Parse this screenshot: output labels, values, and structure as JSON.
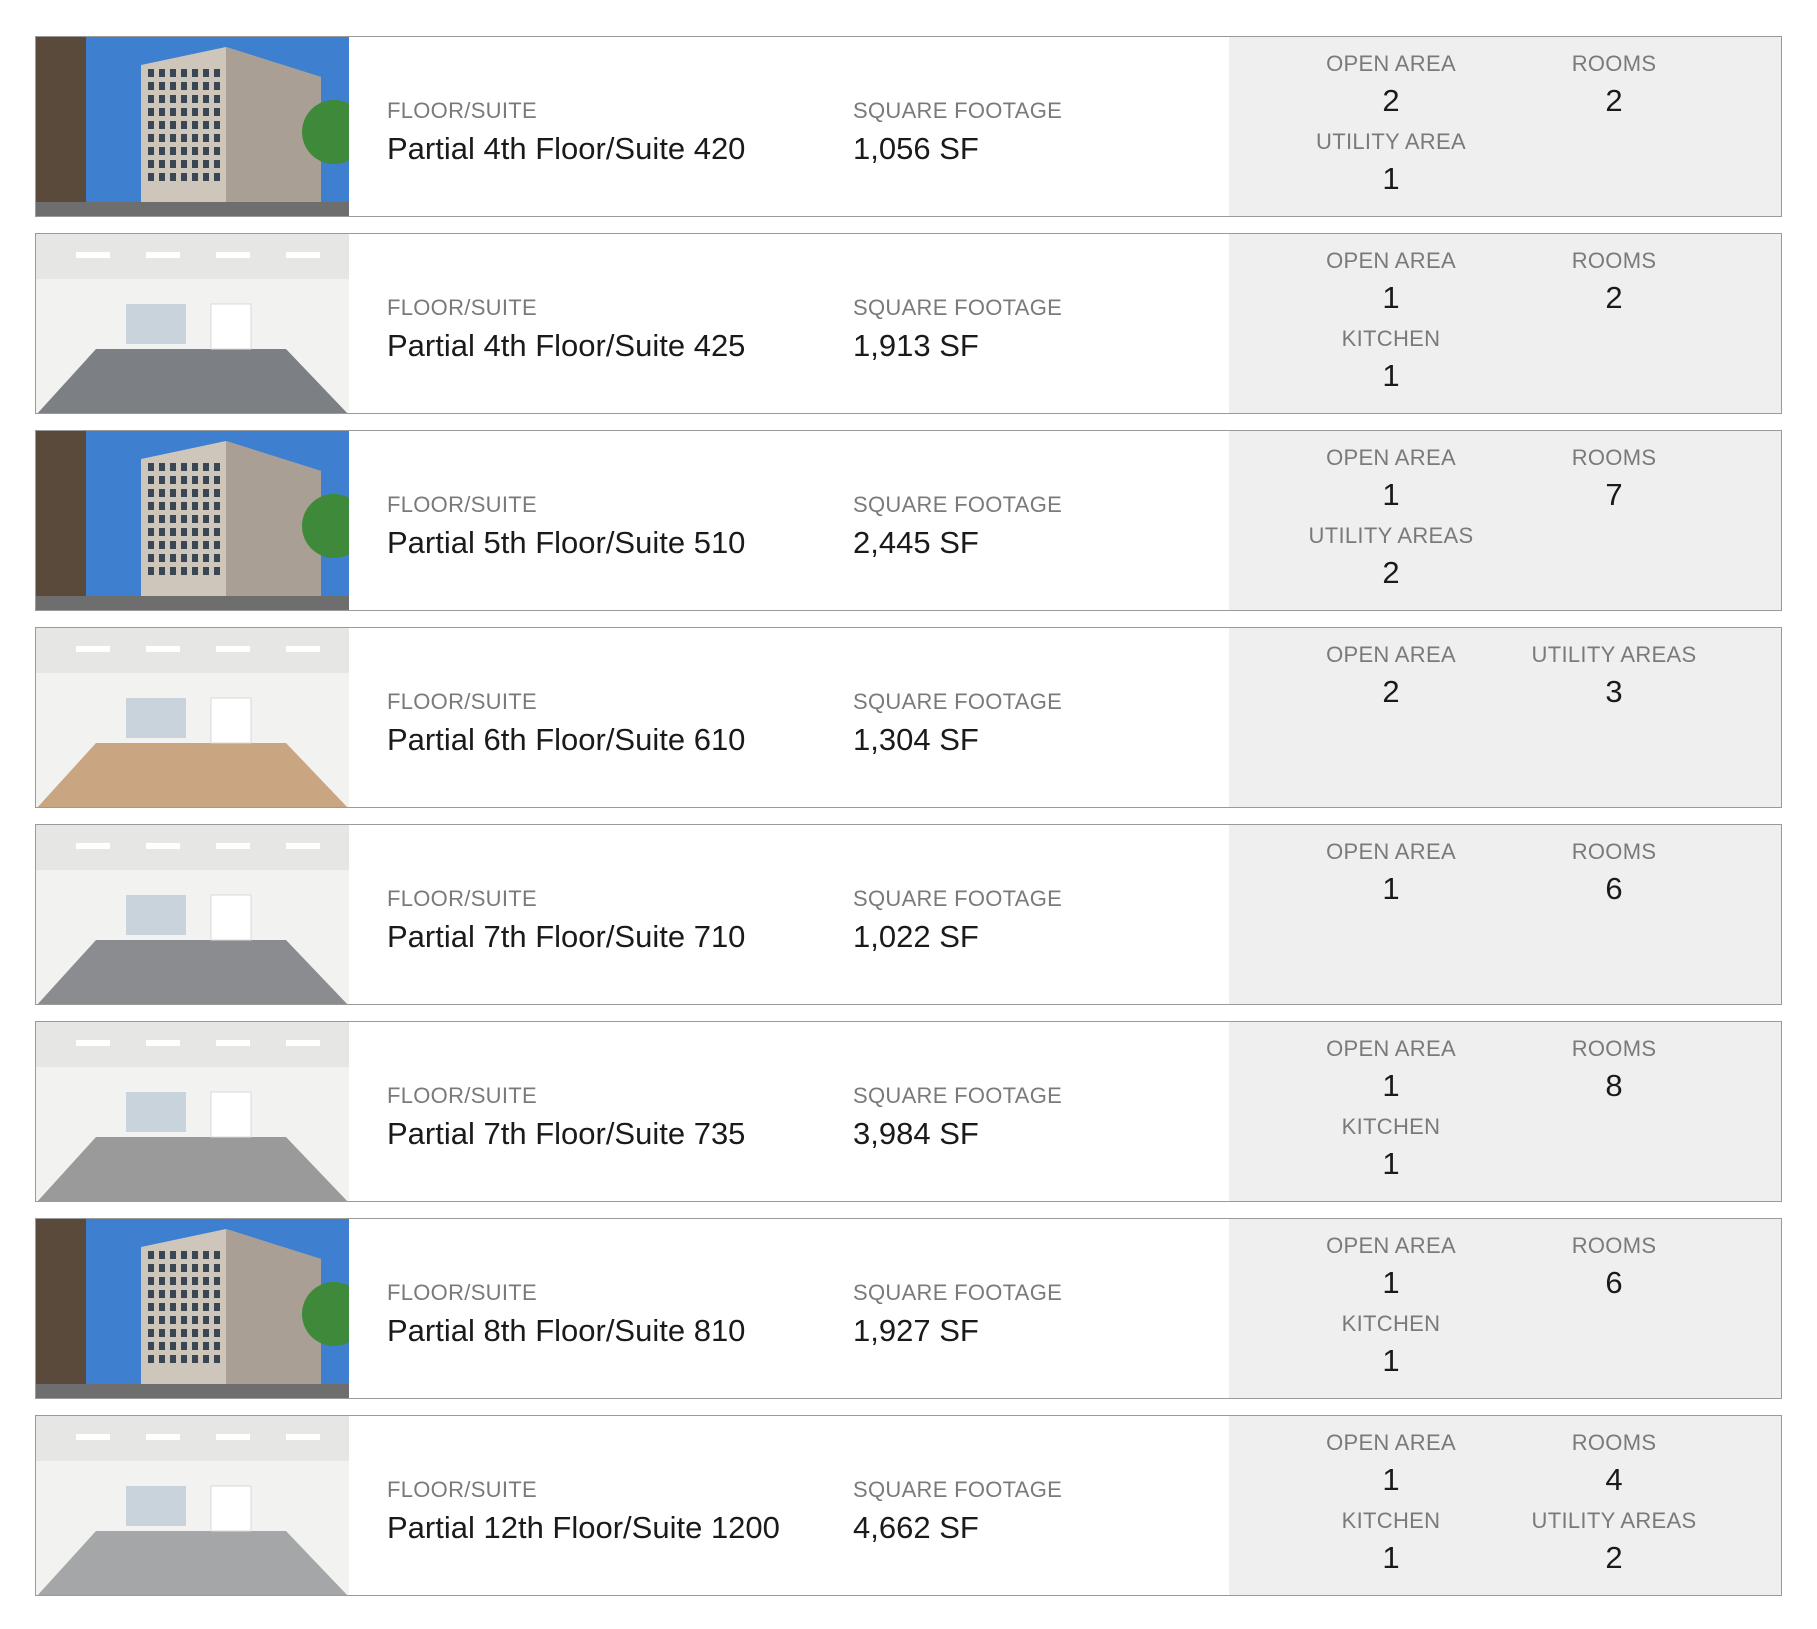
{
  "labels": {
    "floor_suite": "FLOOR/SUITE",
    "square_footage": "SQUARE FOOTAGE"
  },
  "listings": [
    {
      "photo": "building-exterior-photo",
      "suite": "Partial 4th Floor/Suite 420",
      "sf": "1,056 SF",
      "stats": [
        {
          "label": "OPEN AREA",
          "value": "2"
        },
        {
          "label": "ROOMS",
          "value": "2"
        },
        {
          "label": "UTILITY AREA",
          "value": "1"
        }
      ]
    },
    {
      "photo": "interior-empty-office-photo",
      "suite": "Partial 4th Floor/Suite 425",
      "sf": "1,913 SF",
      "stats": [
        {
          "label": "OPEN AREA",
          "value": "1"
        },
        {
          "label": "ROOMS",
          "value": "2"
        },
        {
          "label": "KITCHEN",
          "value": "1"
        }
      ]
    },
    {
      "photo": "building-exterior-photo",
      "suite": "Partial 5th Floor/Suite 510",
      "sf": "2,445 SF",
      "stats": [
        {
          "label": "OPEN AREA",
          "value": "1"
        },
        {
          "label": "ROOMS",
          "value": "7"
        },
        {
          "label": "UTILITY AREAS",
          "value": "2"
        }
      ]
    },
    {
      "photo": "interior-conference-photo",
      "suite": "Partial 6th Floor/Suite 610",
      "sf": "1,304 SF",
      "stats": [
        {
          "label": "OPEN AREA",
          "value": "2"
        },
        {
          "label": "UTILITY AREAS",
          "value": "3"
        }
      ]
    },
    {
      "photo": "interior-glass-doors-photo",
      "suite": "Partial 7th Floor/Suite 710",
      "sf": "1,022 SF",
      "stats": [
        {
          "label": "OPEN AREA",
          "value": "1"
        },
        {
          "label": "ROOMS",
          "value": "6"
        }
      ]
    },
    {
      "photo": "interior-open-desks-photo",
      "suite": "Partial 7th Floor/Suite 735",
      "sf": "3,984 SF",
      "stats": [
        {
          "label": "OPEN AREA",
          "value": "1"
        },
        {
          "label": "ROOMS",
          "value": "8"
        },
        {
          "label": "KITCHEN",
          "value": "1"
        }
      ]
    },
    {
      "photo": "building-exterior-photo",
      "suite": "Partial 8th Floor/Suite 810",
      "sf": "1,927 SF",
      "stats": [
        {
          "label": "OPEN AREA",
          "value": "1"
        },
        {
          "label": "ROOMS",
          "value": "6"
        },
        {
          "label": "KITCHEN",
          "value": "1"
        }
      ]
    },
    {
      "photo": "interior-lounge-photo",
      "suite": "Partial 12th Floor/Suite 1200",
      "sf": "4,662 SF",
      "stats": [
        {
          "label": "OPEN AREA",
          "value": "1"
        },
        {
          "label": "ROOMS",
          "value": "4"
        },
        {
          "label": "KITCHEN",
          "value": "1"
        },
        {
          "label": "UTILITY AREAS",
          "value": "2"
        }
      ]
    }
  ]
}
